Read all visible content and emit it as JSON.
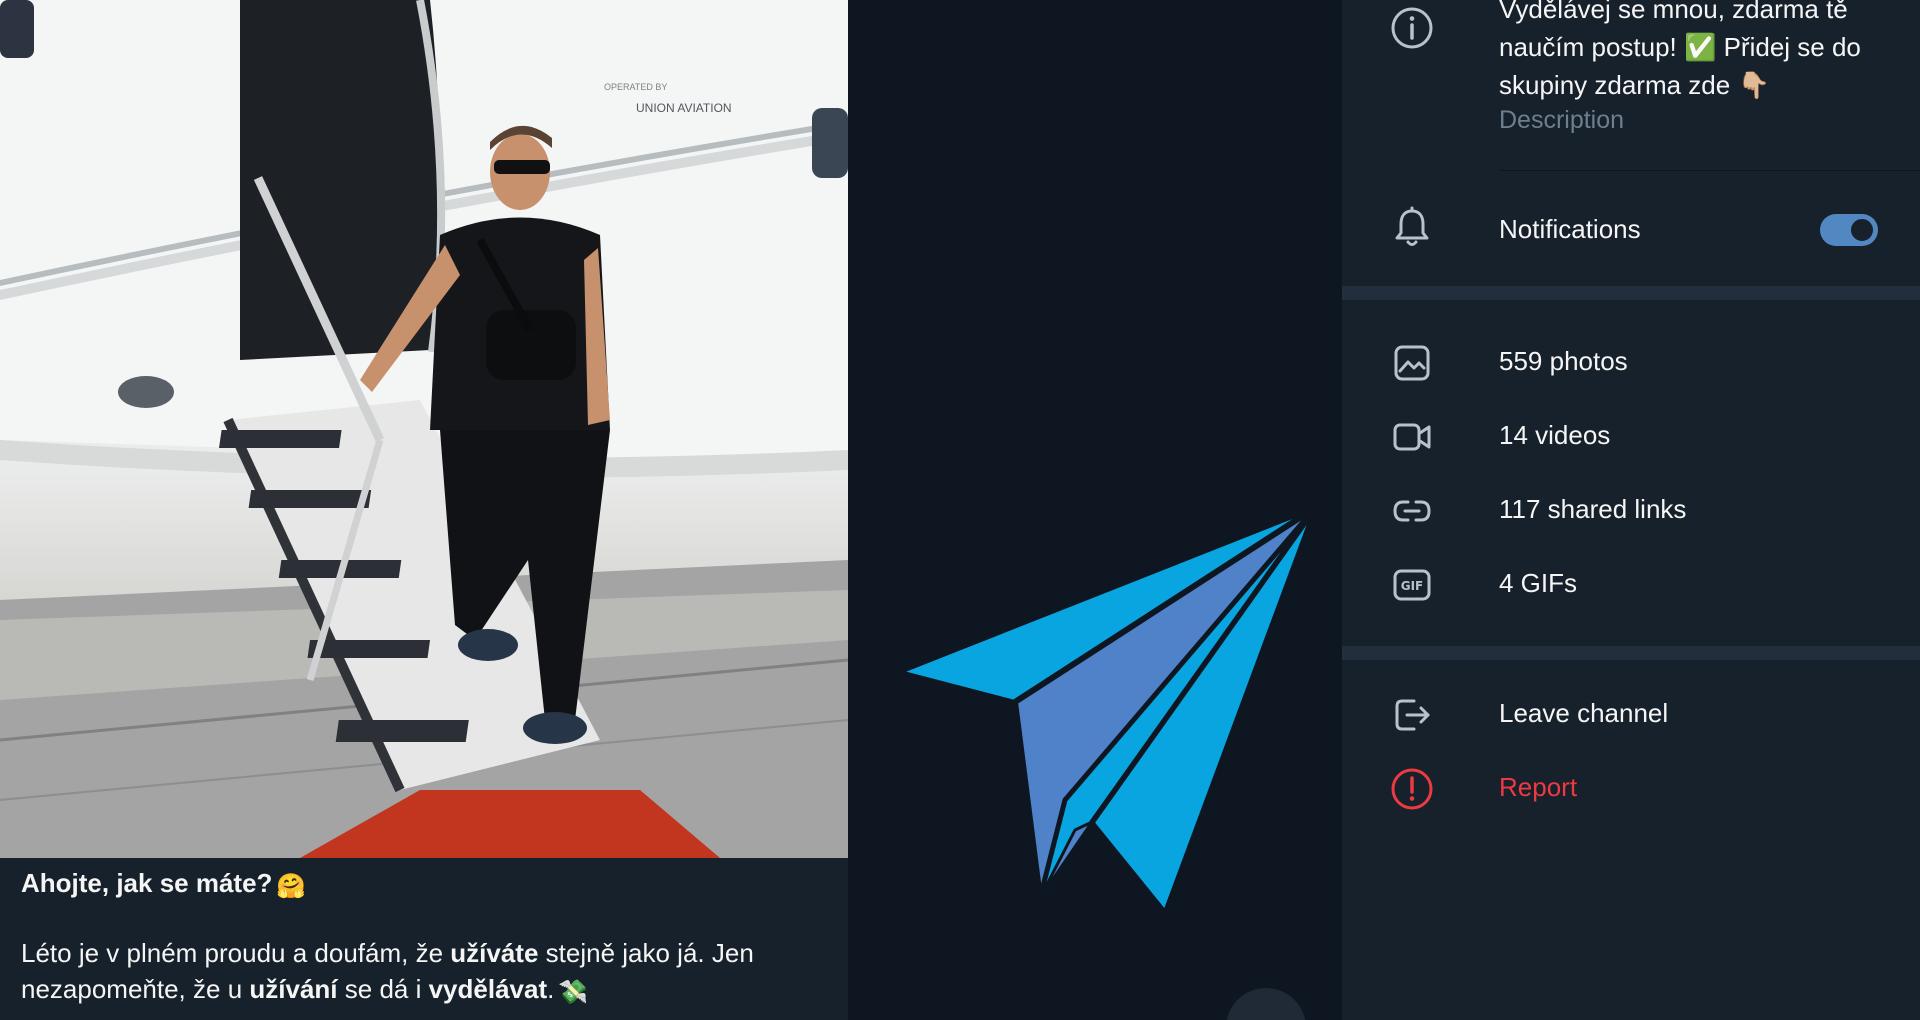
{
  "message": {
    "greeting": "Ahojte, jak se máte?",
    "greeting_emoji": "🤗",
    "body_parts": {
      "p1": "Léto je v plném proudu a doufám, že ",
      "b1": "užíváte",
      "p2": " stejně jako já. Jen nezapomeňte, že u ",
      "b2": "užívání",
      "p3": " se dá i ",
      "b3": "vydělávat",
      "p4": ".",
      "emoji": "💸"
    },
    "photo": {
      "aircraft_text_small": "OPERATED BY",
      "aircraft_text": "UNION AVIATION"
    }
  },
  "info": {
    "description_text": "Vydělávej se mnou, zdarma tě naučím postup! ✅ Přidej se do skupiny zdarma zde 👇🏼",
    "description_label": "Description",
    "notifications_label": "Notifications",
    "notifications_on": true,
    "media": {
      "photos": "559 photos",
      "videos": "14 videos",
      "links": "117 shared links",
      "gifs": "4 GIFs"
    },
    "leave_label": "Leave channel",
    "report_label": "Report"
  },
  "colors": {
    "panel_bg": "#17212b",
    "app_bg": "#0e1621",
    "accent": "#5288c1",
    "danger": "#ec3942",
    "muted": "#6d7f8f",
    "logo_light": "#08a5e0",
    "logo_dark": "#4f82c8"
  },
  "icons": {
    "info": "info-circle-icon",
    "notifications": "bell-icon",
    "photos": "photo-icon",
    "videos": "video-camera-icon",
    "links": "link-icon",
    "gifs": "gif-icon",
    "leave": "exit-icon",
    "report": "alert-circle-icon"
  }
}
